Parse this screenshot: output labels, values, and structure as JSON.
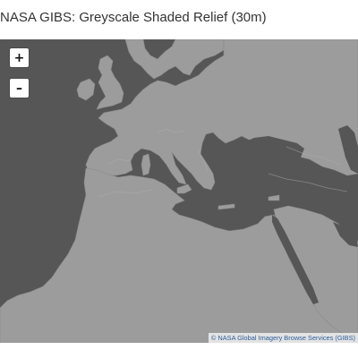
{
  "page": {
    "title": "NASA GIBS: Greyscale Shaded Relief (30m)"
  },
  "map": {
    "layer": "Greyscale Shaded Relief (30m)",
    "colors": {
      "water": "#565656",
      "land": "#9c9c9c"
    },
    "controls": {
      "zoom_in_label": "+",
      "zoom_out_label": "–",
      "zoom_in_icon": "plus-icon",
      "zoom_out_icon": "minus-icon"
    },
    "attribution": "© NASA Global Imagery Browse Services (GIBS)"
  }
}
